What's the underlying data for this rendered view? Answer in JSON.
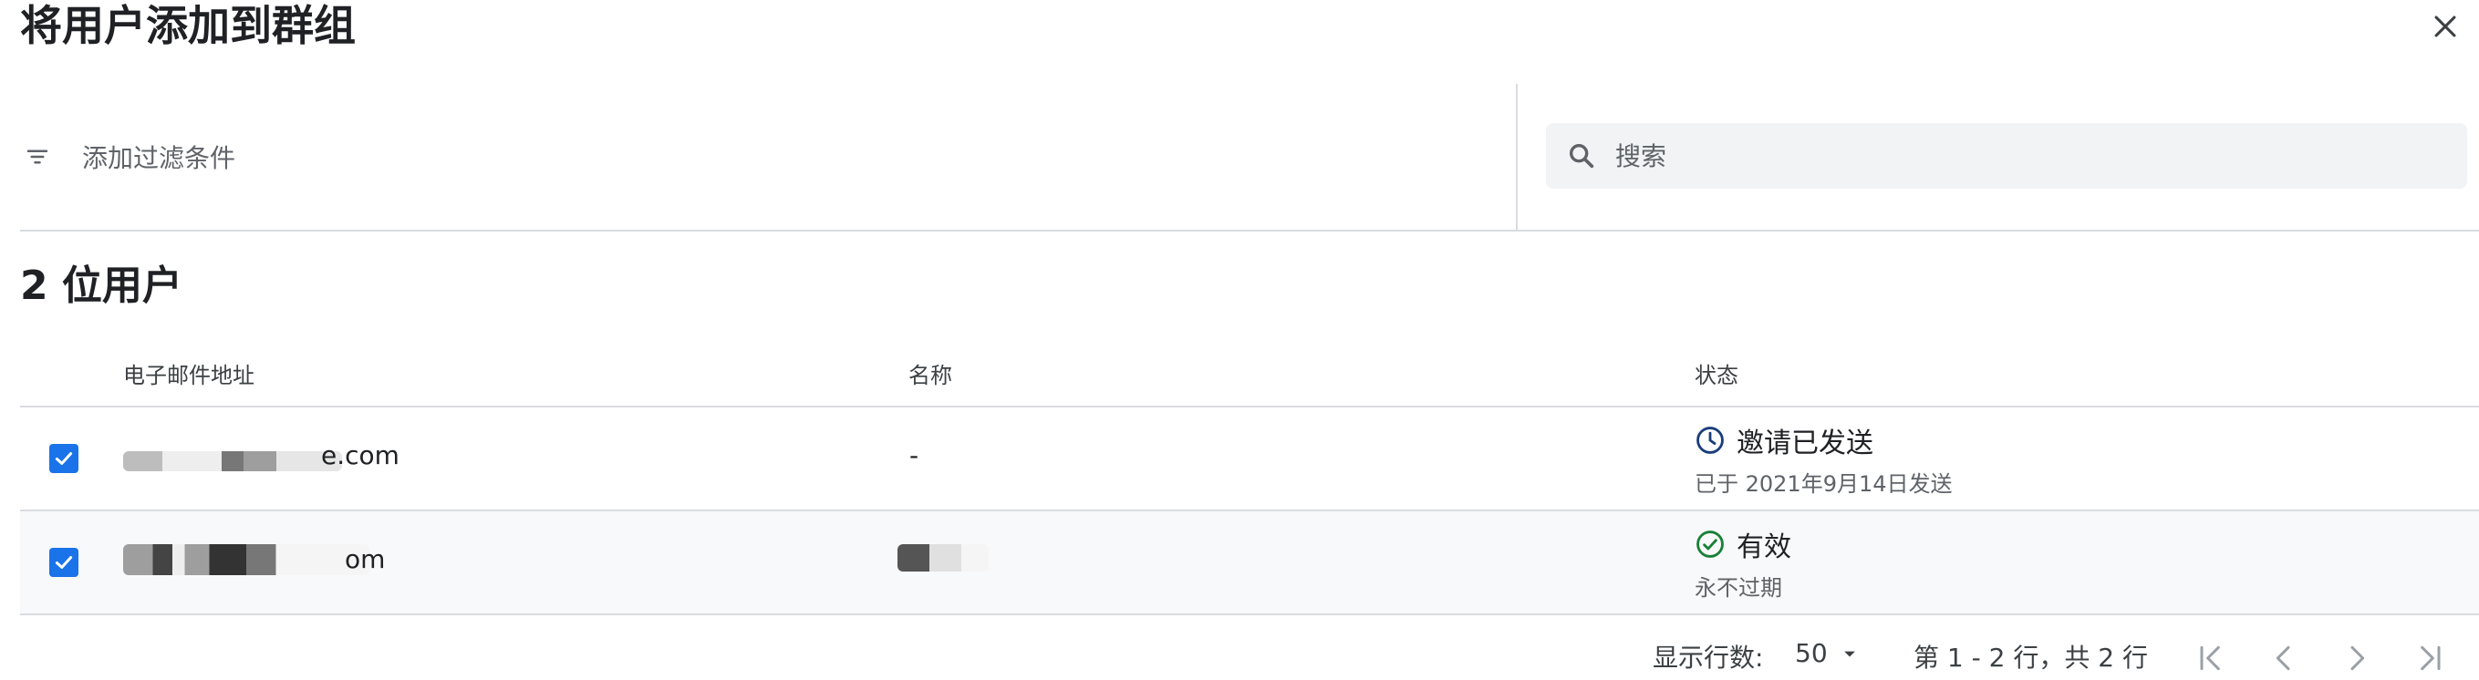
{
  "dialog": {
    "title": "将用户添加到群组"
  },
  "filter": {
    "label": "添加过滤条件"
  },
  "search": {
    "placeholder": "搜索"
  },
  "users": {
    "count_title": "2 位用户",
    "columns": [
      "电子邮件地址",
      "名称",
      "状态"
    ],
    "rows": [
      {
        "email_visible": "e.com",
        "name": "-",
        "status": "邀请已发送",
        "status_sub": "已于 2021年9月14日发送",
        "checked": true
      },
      {
        "email_visible": "om",
        "name": "",
        "status": "有效",
        "status_sub": "永不过期",
        "checked": true
      }
    ]
  },
  "pagination": {
    "rows_label": "显示行数:",
    "rows_value": "50",
    "range": "第 1 - 2 行，共 2 行"
  },
  "colors": {
    "accent": "#1a73e8",
    "text": "#202124",
    "secondary": "#5f6368",
    "divider": "#dadce0",
    "pending": "#1a3d7c",
    "active": "#188038"
  }
}
